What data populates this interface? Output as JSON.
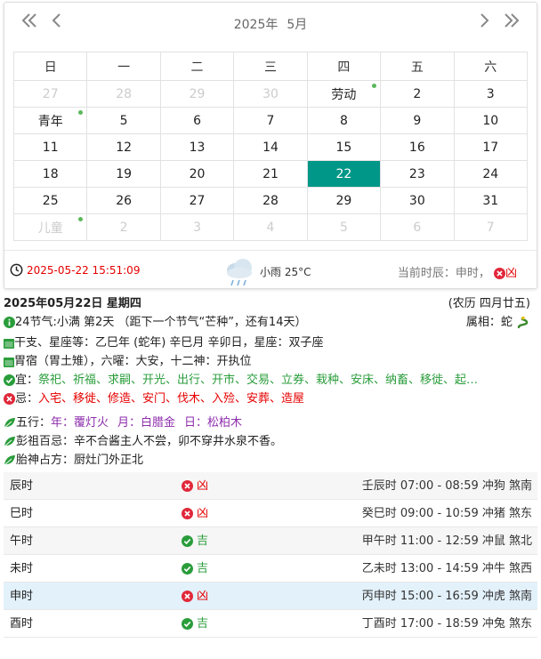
{
  "calendar": {
    "year_label": "2025年",
    "month_label": "5月",
    "weekdays": [
      "日",
      "一",
      "二",
      "三",
      "四",
      "五",
      "六"
    ],
    "weeks": [
      [
        {
          "t": "27",
          "o": true
        },
        {
          "t": "28",
          "o": true
        },
        {
          "t": "29",
          "o": true
        },
        {
          "t": "30",
          "o": true
        },
        {
          "t": "劳动",
          "dot": true
        },
        {
          "t": "2"
        },
        {
          "t": "3"
        }
      ],
      [
        {
          "t": "青年",
          "dot": true
        },
        {
          "t": "5"
        },
        {
          "t": "6"
        },
        {
          "t": "7"
        },
        {
          "t": "8"
        },
        {
          "t": "9"
        },
        {
          "t": "10"
        }
      ],
      [
        {
          "t": "11"
        },
        {
          "t": "12"
        },
        {
          "t": "13"
        },
        {
          "t": "14"
        },
        {
          "t": "15"
        },
        {
          "t": "16"
        },
        {
          "t": "17"
        }
      ],
      [
        {
          "t": "18"
        },
        {
          "t": "19"
        },
        {
          "t": "20"
        },
        {
          "t": "21"
        },
        {
          "t": "22",
          "sel": true
        },
        {
          "t": "23"
        },
        {
          "t": "24"
        }
      ],
      [
        {
          "t": "25"
        },
        {
          "t": "26"
        },
        {
          "t": "27"
        },
        {
          "t": "28"
        },
        {
          "t": "29"
        },
        {
          "t": "30"
        },
        {
          "t": "31"
        }
      ],
      [
        {
          "t": "儿童",
          "o": true,
          "dot": true
        },
        {
          "t": "2",
          "o": true
        },
        {
          "t": "3",
          "o": true
        },
        {
          "t": "4",
          "o": true
        },
        {
          "t": "5",
          "o": true
        },
        {
          "t": "6",
          "o": true
        },
        {
          "t": "7",
          "o": true
        }
      ]
    ]
  },
  "status": {
    "datetime": "2025-05-22 15:51:09",
    "weather": "小雨 25°C",
    "shichen_label": "当前时辰：申时，",
    "shichen_luck": "凶"
  },
  "info": {
    "date_title": "2025年05月22日 星期四",
    "lunar": "(农历 四月廿五)",
    "jieqi": "24节气:小满 第2天 （距下一个节气“芒种”，还有14天）",
    "zodiac": "属相：蛇",
    "ganzhi": "干支、星座等：乙巳年 (蛇年) 辛巳月 辛卯日，星座：双子座",
    "xiusu": "胃宿（胃土雉），六曜：大安，十二神：开执位",
    "yi_label": "宜：",
    "yi_items": "祭祀、祈福、求嗣、开光、出行、开市、交易、立券、栽种、安床、纳畜、移徙、起…",
    "ji_label": "忌：",
    "ji_items": "入宅、移徙、修造、安门、伐木、入殓、安葬、造屋",
    "wuxing_label": "五行：",
    "wuxing_year": "年：覆灯火",
    "wuxing_month": "月：白腊金",
    "wuxing_day": "日：松柏木",
    "pengzu": "彭祖百忌：辛不合酱主人不尝，卯不穿井水泉不香。",
    "taishen": "胎神占方：厨灶门外正北"
  },
  "hours": [
    {
      "name": "辰时",
      "luck": "凶",
      "detail": "壬辰时 07:00 - 08:59 冲狗 煞南"
    },
    {
      "name": "巳时",
      "luck": "凶",
      "detail": "癸巳时 09:00 - 10:59 冲猪 煞东"
    },
    {
      "name": "午时",
      "luck": "吉",
      "detail": "甲午时 11:00 - 12:59 冲鼠 煞北"
    },
    {
      "name": "未时",
      "luck": "吉",
      "detail": "乙未时 13:00 - 14:59 冲牛 煞西"
    },
    {
      "name": "申时",
      "luck": "凶",
      "detail": "丙申时 15:00 - 16:59 冲虎 煞南",
      "current": true
    },
    {
      "name": "酉时",
      "luck": "吉",
      "detail": "丁酉时 17:00 - 18:59 冲兔 煞东"
    }
  ],
  "colors": {
    "accent": "#009688",
    "red": "#e60000",
    "green": "#2a9d3b",
    "purple": "#8e2dad"
  }
}
